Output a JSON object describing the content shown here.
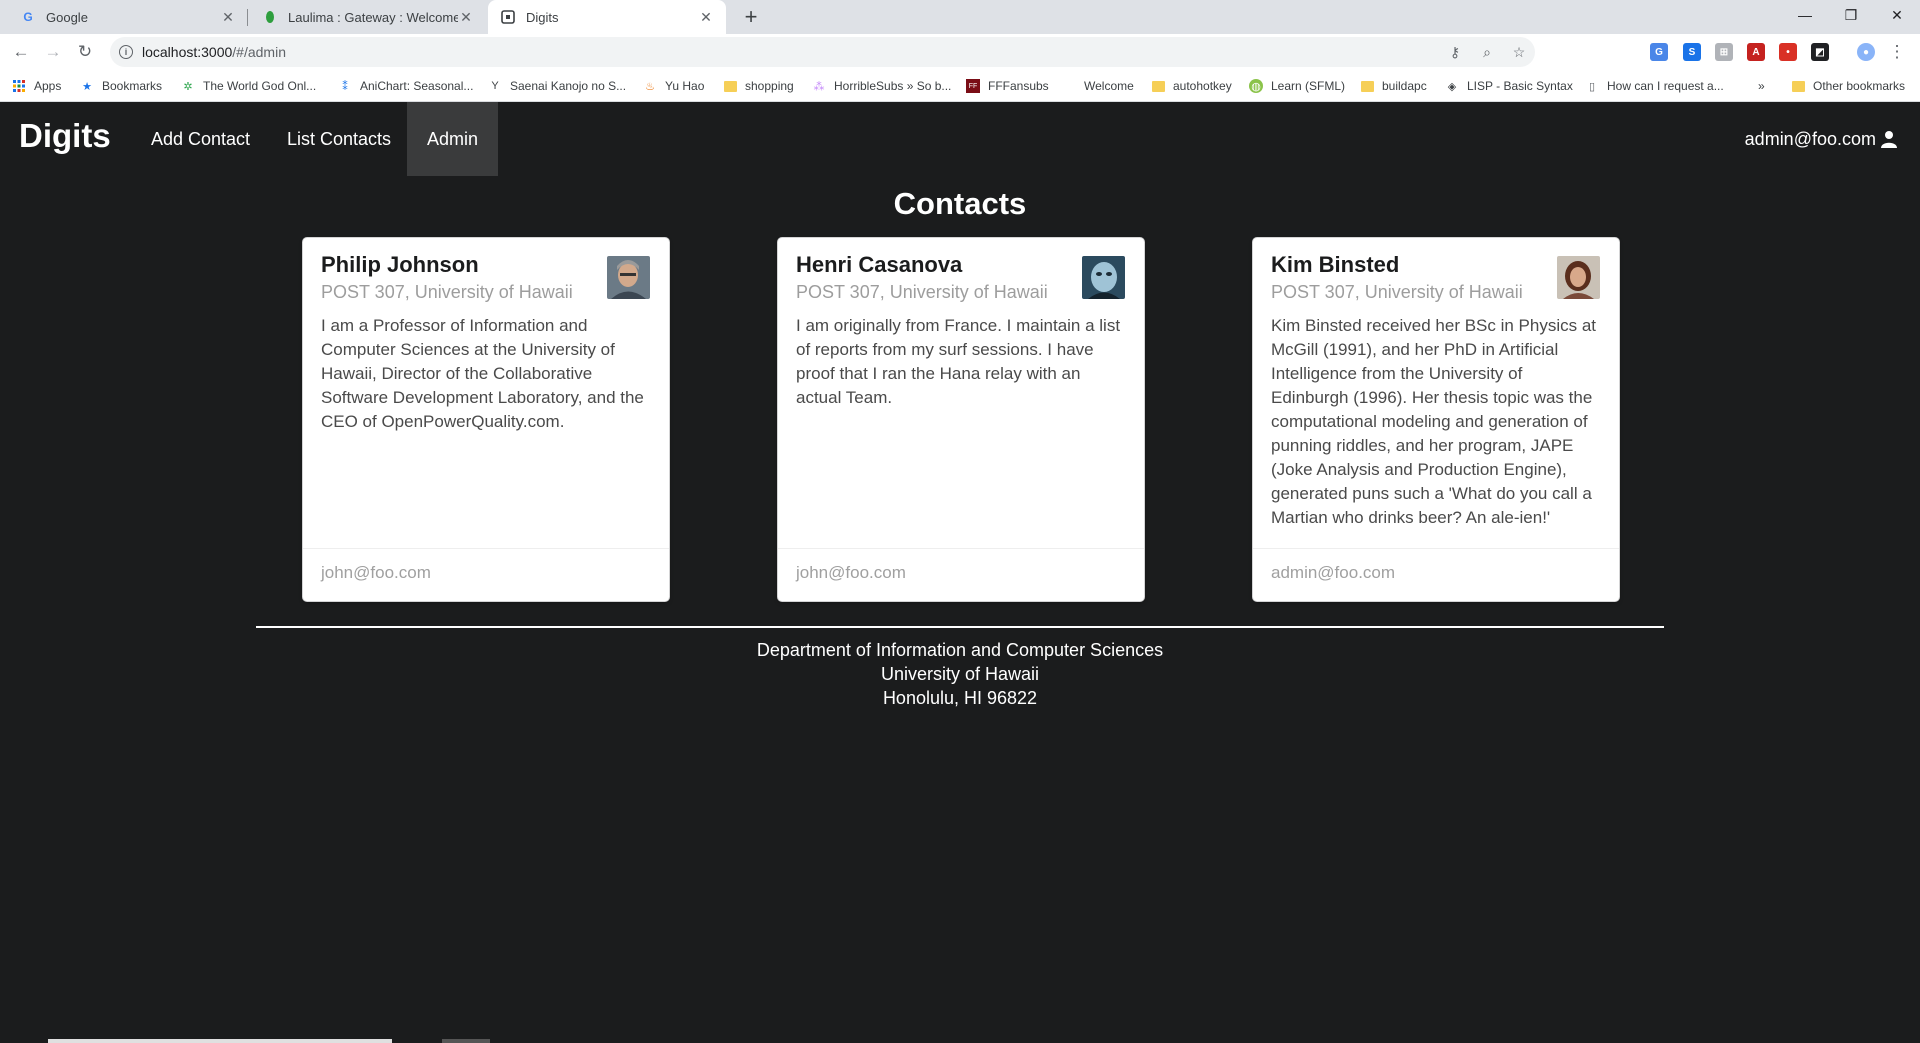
{
  "browser": {
    "tabs": [
      {
        "title": "Google",
        "favicon": "G"
      },
      {
        "title": "Laulima : Gateway : Welcome",
        "favicon": "leaf-icon"
      },
      {
        "title": "Digits",
        "favicon": "digits-icon"
      }
    ],
    "url_host": "localhost:3000",
    "url_path": "/#/admin",
    "bookmarks": [
      {
        "label": "Apps",
        "icon": "apps-grid-icon"
      },
      {
        "label": "Bookmarks",
        "icon": "star-icon"
      },
      {
        "label": "The World God Onl...",
        "icon": "site-icon"
      },
      {
        "label": "AniChart: Seasonal...",
        "icon": "site-icon"
      },
      {
        "label": "Saenai Kanojo no S...",
        "icon": "site-icon"
      },
      {
        "label": "Yu Hao",
        "icon": "site-icon"
      },
      {
        "label": "shopping",
        "icon": "folder-icon"
      },
      {
        "label": "HorribleSubs » So b...",
        "icon": "site-icon"
      },
      {
        "label": "FFFansubs",
        "icon": "site-icon"
      },
      {
        "label": "Welcome",
        "icon": "blank-icon"
      },
      {
        "label": "autohotkey",
        "icon": "folder-icon"
      },
      {
        "label": "Learn (SFML)",
        "icon": "site-icon"
      },
      {
        "label": "buildapc",
        "icon": "folder-icon"
      },
      {
        "label": "LISP - Basic Syntax",
        "icon": "site-icon"
      },
      {
        "label": "How can I request a...",
        "icon": "page-icon"
      },
      {
        "label": "»",
        "icon": "overflow-icon"
      },
      {
        "label": "Other bookmarks",
        "icon": "folder-icon"
      }
    ]
  },
  "app": {
    "brand": "Digits",
    "nav": [
      "Add Contact",
      "List Contacts",
      "Admin"
    ],
    "active_nav": "Admin",
    "user": "admin@foo.com",
    "page_title": "Contacts",
    "contacts": [
      {
        "name": "Philip Johnson",
        "address": "POST 307, University of Hawaii",
        "description": "I am a Professor of Information and Computer Sciences at the University of Hawaii, Director of the Collaborative Software Development Laboratory, and the CEO of OpenPowerQuality.com.",
        "email": "john@foo.com"
      },
      {
        "name": "Henri Casanova",
        "address": "POST 307, University of Hawaii",
        "description": "I am originally from France. I maintain a list of reports from my surf sessions. I have proof that I ran the Hana relay with an actual Team.",
        "email": "john@foo.com"
      },
      {
        "name": "Kim Binsted",
        "address": "POST 307, University of Hawaii",
        "description": "Kim Binsted received her BSc in Physics at McGill (1991), and her PhD in Artificial Intelligence from the University of Edinburgh (1996). Her thesis topic was the computational modeling and generation of punning riddles, and her program, JAPE (Joke Analysis and Production Engine), generated puns such a 'What do you call a Martian who drinks beer? An ale-ien!'",
        "email": "admin@foo.com"
      }
    ],
    "footer": [
      "Department of Information and Computer Sciences",
      "University of Hawaii",
      "Honolulu, HI 96822"
    ]
  },
  "colors": {
    "background": "#1b1c1d",
    "active_nav": "#3a3b3c",
    "card": "#ffffff",
    "muted_text": "#9d9d9d"
  }
}
